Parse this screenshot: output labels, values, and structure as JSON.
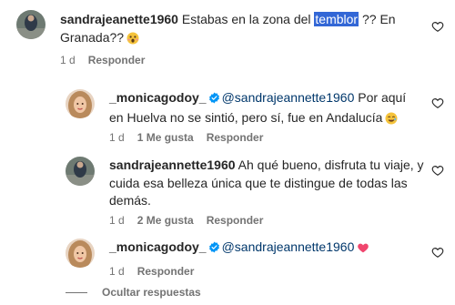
{
  "comments": [
    {
      "username": "sandrajeanette1960",
      "text_before": " Estabas en la zona del ",
      "highlight": "temblor",
      "text_after": " ?? En Granada??",
      "time": "1 d",
      "reply": "Responder",
      "emoji_icon": "astonished-face-emoji"
    },
    {
      "username": "_monicagodoy_",
      "mention": "@sandrajeannette1960",
      "text": " Por aquí en Huelva no se sintió, pero sí, fue en Andalucía",
      "time": "1 d",
      "likes": "1 Me gusta",
      "reply": "Responder",
      "emoji_icon": "smiling-face-with-tear-emoji"
    },
    {
      "username": "sandrajeannette1960",
      "text": " Ah qué bueno, disfruta tu viaje, y cuida esa belleza única que te distingue de todas las demás.",
      "time": "1 d",
      "likes": "2 Me gusta",
      "reply": "Responder"
    },
    {
      "username": "_monicagodoy_",
      "mention": "@sandrajeannette1960",
      "text": "",
      "time": "1 d",
      "reply": "Responder",
      "emoji_icon": "pink-heart-emoji"
    }
  ],
  "hide_replies": "Ocultar respuestas",
  "colors": {
    "text": "#262626",
    "meta": "#737373",
    "mention": "#00376b",
    "verified": "#0095f6",
    "selection": "#3367d6"
  }
}
